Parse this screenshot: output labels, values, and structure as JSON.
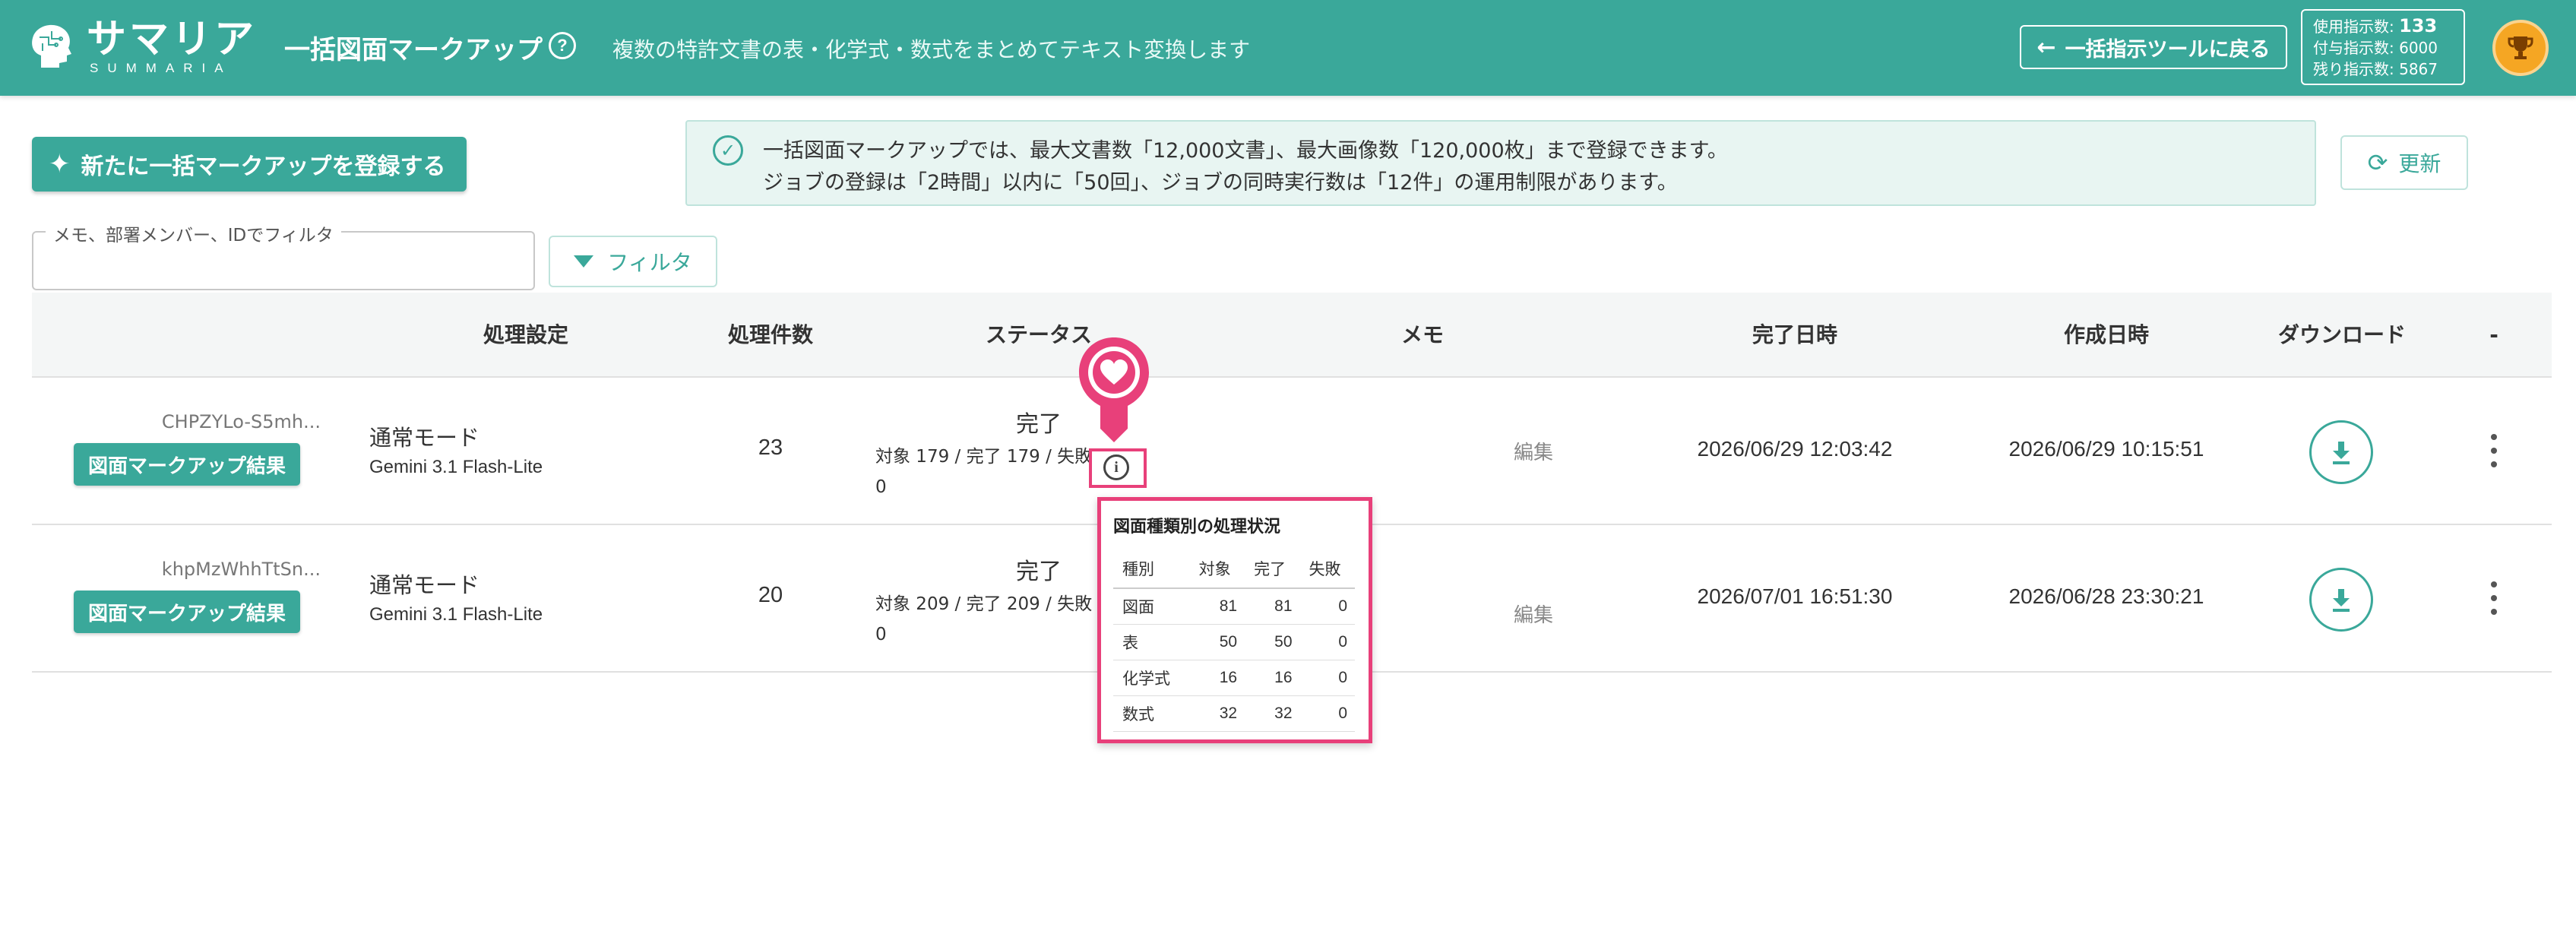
{
  "header": {
    "logo_jp": "サマリア",
    "logo_en": "SUMMARIA",
    "title": "一括図面マークアップ",
    "help_icon": "?",
    "description": "複数の特許文書の表・化学式・数式をまとめてテキスト変換します",
    "back_button": "一括指示ツールに戻る",
    "usage": {
      "used_label": "使用指示数:",
      "used_value": "133",
      "granted_label": "付与指示数:",
      "granted_value": "6000",
      "remaining_label": "残り指示数:",
      "remaining_value": "5867"
    },
    "trophy_icon": "trophy-icon"
  },
  "toolbar": {
    "register_button": "新たに一括マークアップを登録する",
    "notice_line1": "一括図面マークアップでは、最大文書数「12,000文書」、最大画像数「120,000枚」まで登録できます。",
    "notice_line2": "ジョブの登録は「2時間」以内に「50回」、ジョブの同時実行数は「12件」の運用制限があります。",
    "refresh_button": "更新",
    "filter_label": "メモ、部署メンバー、IDでフィルタ",
    "filter_value": "",
    "filter_button": "フィルタ"
  },
  "table": {
    "headers": {
      "settings": "処理設定",
      "count": "処理件数",
      "status": "ステータス",
      "memo": "メモ",
      "done": "完了日時",
      "created": "作成日時",
      "download": "ダウンロード",
      "menu": "-"
    },
    "rows": [
      {
        "id": "CHPZYLo-S5mh...",
        "result_button": "図面マークアップ結果",
        "mode": "通常モード",
        "model": "Gemini 3.1 Flash-Lite",
        "count": "23",
        "status": "完了",
        "status_detail": "対象 179 / 完了 179 / 失敗 0",
        "memo": "編集",
        "done": "2026/06/29 12:03:42",
        "created": "2026/06/29 10:15:51"
      },
      {
        "id": "khpMzWhhTtSn...",
        "result_button": "図面マークアップ結果",
        "mode": "通常モード",
        "model": "Gemini 3.1 Flash-Lite",
        "count": "20",
        "status": "完了",
        "status_detail": "対象 209 / 完了 209 / 失敗 0",
        "memo": "編集",
        "done": "2026/07/01 16:51:30",
        "created": "2026/06/28 23:30:21"
      }
    ]
  },
  "popup": {
    "title": "図面種類別の処理状況",
    "columns": [
      "種別",
      "対象",
      "完了",
      "失敗"
    ],
    "rows": [
      [
        "図面",
        "81",
        "81",
        "0"
      ],
      [
        "表",
        "50",
        "50",
        "0"
      ],
      [
        "化学式",
        "16",
        "16",
        "0"
      ],
      [
        "数式",
        "32",
        "32",
        "0"
      ]
    ]
  },
  "colors": {
    "primary": "#3aa89a",
    "highlight": "#e8407a",
    "notice_bg": "#e8f5f2"
  }
}
